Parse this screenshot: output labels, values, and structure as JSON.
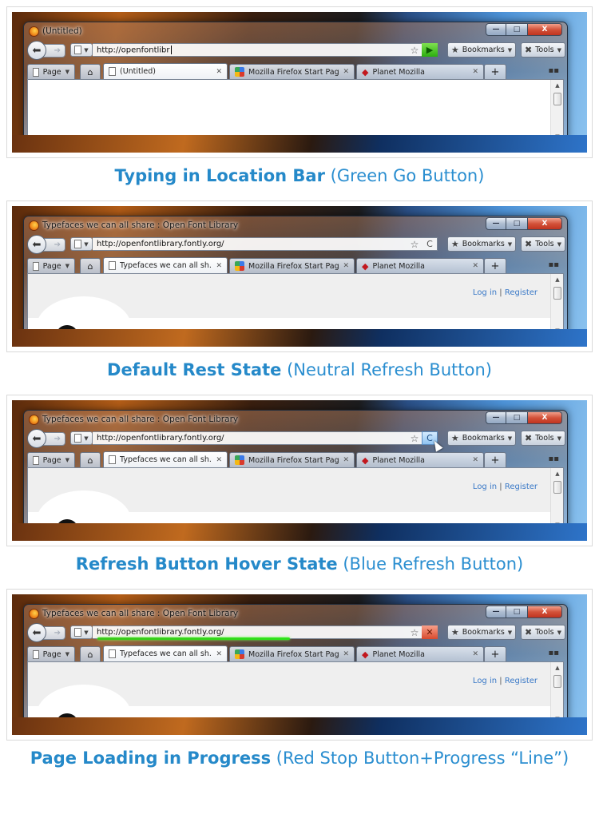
{
  "window_buttons": {
    "minimize": "—",
    "maximize": "□",
    "close": "X"
  },
  "toolbar": {
    "bookmarks_label": "Bookmarks",
    "tools_label": "Tools",
    "page_menu_label": "Page"
  },
  "icons": {
    "back": "back-arrow-icon",
    "forward": "forward-arrow-icon",
    "home": "home-icon",
    "star": "bookmark-star-icon",
    "new_tab": "plus-icon"
  },
  "tabs_common": {
    "tab2_label": "Mozilla Firefox Start Page",
    "tab3_label": "Planet Mozilla"
  },
  "colors": {
    "caption": "#2a8ed0",
    "go_green": "#2cae0f",
    "hover_blue": "#8fc3f2",
    "stop_red": "#d84a2e",
    "progress_green": "#3cc81a",
    "link": "#3a79c7"
  },
  "panels": [
    {
      "title": "(Untitled)",
      "url": "http://openfontlibr",
      "go_button": "▶",
      "tab1_label": "(Untitled)",
      "login": "",
      "register": "",
      "caption_bold": "Typing in Location Bar",
      "caption_rest": "(Green Go Button)"
    },
    {
      "title": "Typefaces we can all share : Open Font Library",
      "url": "http://openfontlibrary.fontly.org/",
      "go_button": "C",
      "tab1_label": "Typefaces we can all sh...",
      "login": "Log in",
      "register": "Register",
      "caption_bold": "Default Rest State",
      "caption_rest": "(Neutral Refresh Button)"
    },
    {
      "title": "Typefaces we can all share : Open Font Library",
      "url": "http://openfontlibrary.fontly.org/",
      "go_button": "C",
      "tab1_label": "Typefaces we can all sh...",
      "login": "Log in",
      "register": "Register",
      "caption_bold": "Refresh Button Hover State",
      "caption_rest": "(Blue Refresh Button)"
    },
    {
      "title": "Typefaces we can all share : Open Font Library",
      "url": "http://openfontlibrary.fontly.org/",
      "go_button": "✕",
      "tab1_label": "Typefaces we can all sh...",
      "login": "Log in",
      "register": "Register",
      "progress": 0.56,
      "caption_bold": "Page Loading in Progress",
      "caption_rest": "(Red Stop Button+Progress “Line”)"
    }
  ]
}
